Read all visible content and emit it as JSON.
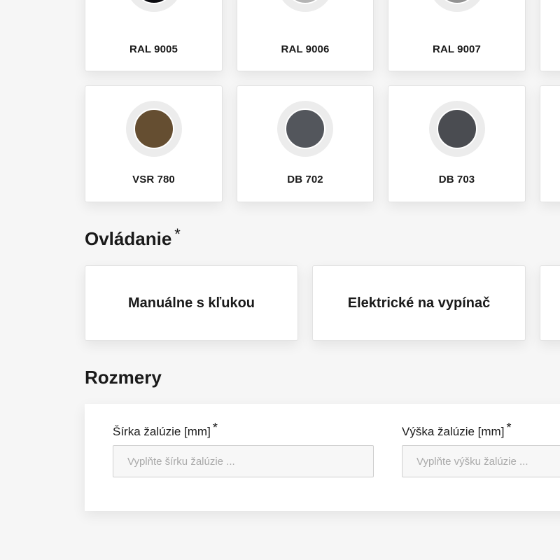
{
  "colors": {
    "row1": [
      {
        "name": "RAL 9005",
        "hex": "#0b0b10"
      },
      {
        "name": "RAL 9006",
        "hex": "#b4b4b4"
      },
      {
        "name": "RAL 9007",
        "hex": "#939393"
      }
    ],
    "row2": [
      {
        "name": "VSR 780",
        "hex": "#654e31"
      },
      {
        "name": "DB 702",
        "hex": "#53565c"
      },
      {
        "name": "DB 703",
        "hex": "#4a4c51"
      }
    ]
  },
  "controls": {
    "title": "Ovládanie",
    "required_mark": "*",
    "options": [
      {
        "label": "Manuálne s kľukou"
      },
      {
        "label": "Elektrické na vypínač"
      },
      {
        "label": ""
      }
    ]
  },
  "dimensions": {
    "title": "Rozmery",
    "width": {
      "label": "Šírka žalúzie [mm]",
      "required_mark": "*",
      "placeholder": "Vyplňte šírku žalúzie ...",
      "value": ""
    },
    "height": {
      "label": "Výška žalúzie [mm]",
      "required_mark": "*",
      "placeholder": "Vyplňte výšku žalúzie ...",
      "value": ""
    }
  }
}
